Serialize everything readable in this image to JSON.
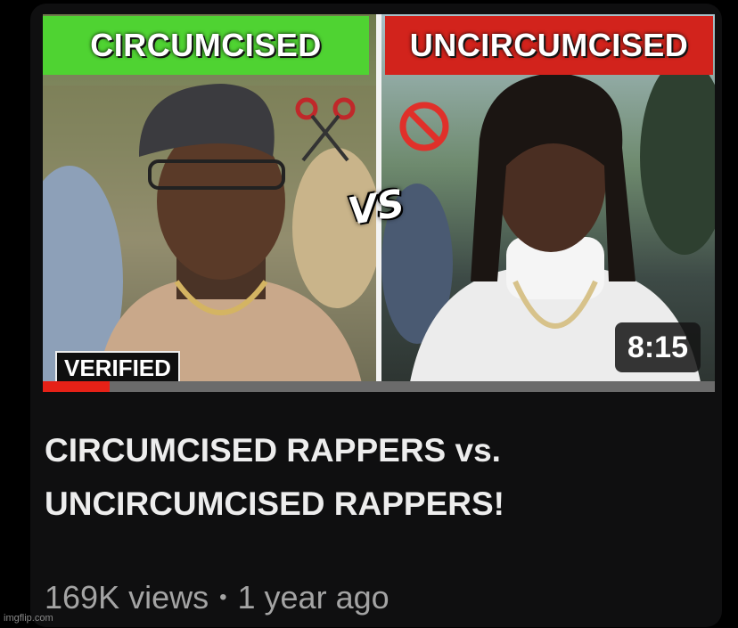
{
  "thumbnail": {
    "banner_left": "CIRCUMCISED",
    "banner_right": "UNCIRCUMCISED",
    "vs_text": "VS",
    "verified_label": "VERIFIED",
    "duration": "8:15",
    "watch_progress": 0.1,
    "colors": {
      "banner_left": "#4fd332",
      "banner_right": "#d2231c",
      "progress": "#e62117"
    },
    "icons": [
      "scissors-icon",
      "no-sign-icon"
    ]
  },
  "video": {
    "title_line1": "CIRCUMCISED RAPPERS vs.",
    "title_line2": "UNCIRCUMCISED RAPPERS!",
    "views": "169K views",
    "separator": "•",
    "age": "1 year ago"
  },
  "watermark": "imgflip.com"
}
